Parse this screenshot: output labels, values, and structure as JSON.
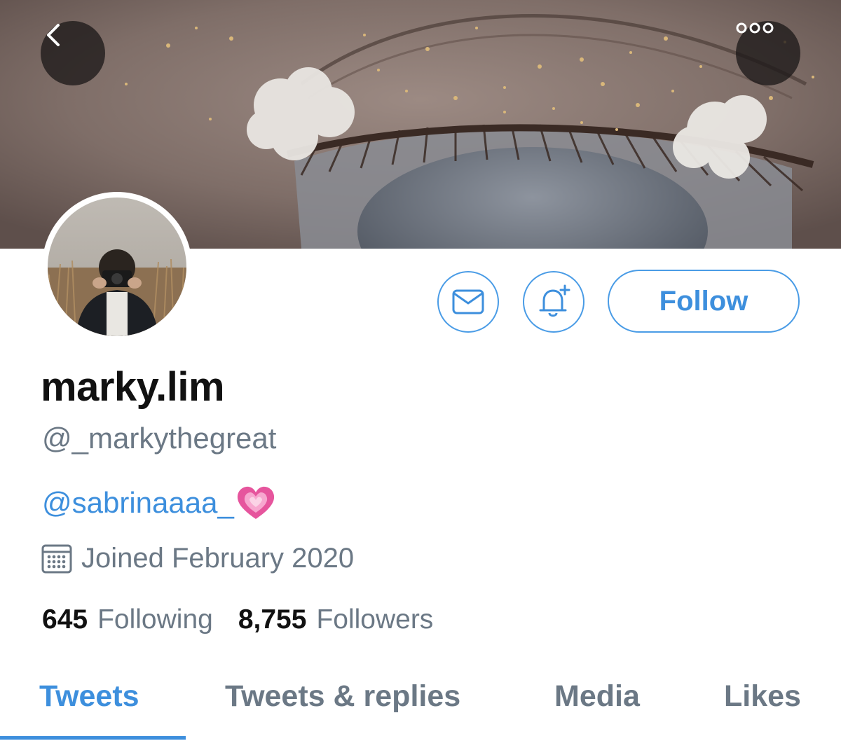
{
  "profile": {
    "display_name": "marky.lim",
    "handle": "@_markythegreat",
    "bio_mention": "@sabrinaaaa_",
    "bio_emoji": "growing-heart-emoji",
    "joined": "Joined February 2020"
  },
  "actions": {
    "follow_label": "Follow",
    "message_icon": "envelope-icon",
    "notify_icon": "bell-plus-icon"
  },
  "nav": {
    "back_icon": "chevron-left-icon",
    "more_icon": "ellipsis-icon"
  },
  "stats": {
    "following_count": "645",
    "following_label": "Following",
    "followers_count": "8,755",
    "followers_label": "Followers"
  },
  "tabs": [
    {
      "label": "Tweets",
      "active": true
    },
    {
      "label": "Tweets & replies",
      "active": false
    },
    {
      "label": "Media",
      "active": false
    },
    {
      "label": "Likes",
      "active": false
    }
  ],
  "colors": {
    "accent": "#3d8fdd",
    "muted_text": "#6b7885",
    "primary_text": "#111111"
  }
}
